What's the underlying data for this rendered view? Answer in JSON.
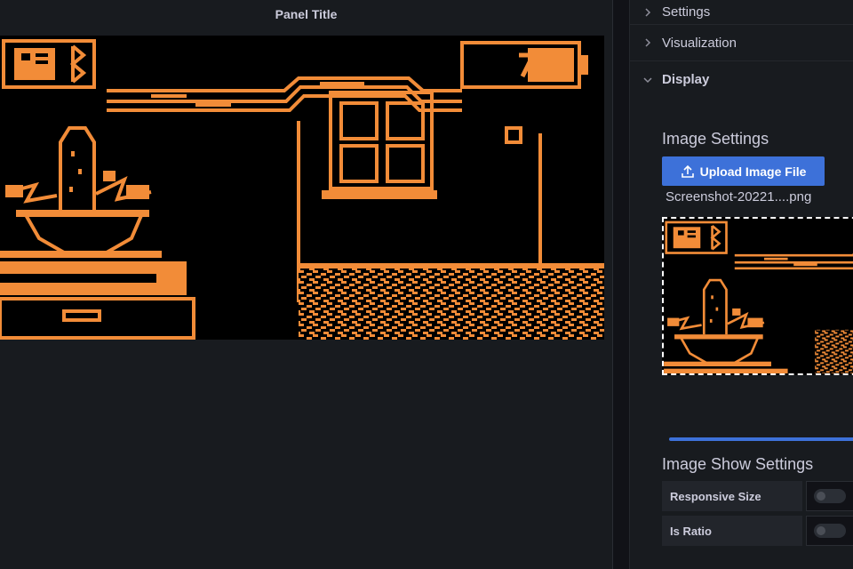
{
  "panel": {
    "title": "Panel Title"
  },
  "options": {
    "sections": [
      {
        "label": "Settings",
        "expanded": false
      },
      {
        "label": "Visualization",
        "expanded": false
      },
      {
        "label": "Display",
        "expanded": true
      }
    ],
    "image_settings": {
      "title": "Image Settings",
      "upload_label": "Upload Image File",
      "filename": "Screenshot-20221....png"
    },
    "image_show_settings": {
      "title": "Image Show Settings",
      "responsive_size_label": "Responsive Size",
      "responsive_size_on": false,
      "is_ratio_label": "Is Ratio",
      "is_ratio_on": false
    }
  },
  "colors": {
    "pixel_art": "#f28c38",
    "accent": "#3d71d9",
    "panel_bg": "#181b1f",
    "page_bg": "#111217"
  },
  "icons": {
    "collapsed": "chevron-right-icon",
    "expanded": "chevron-down-icon",
    "upload": "upload-icon"
  }
}
